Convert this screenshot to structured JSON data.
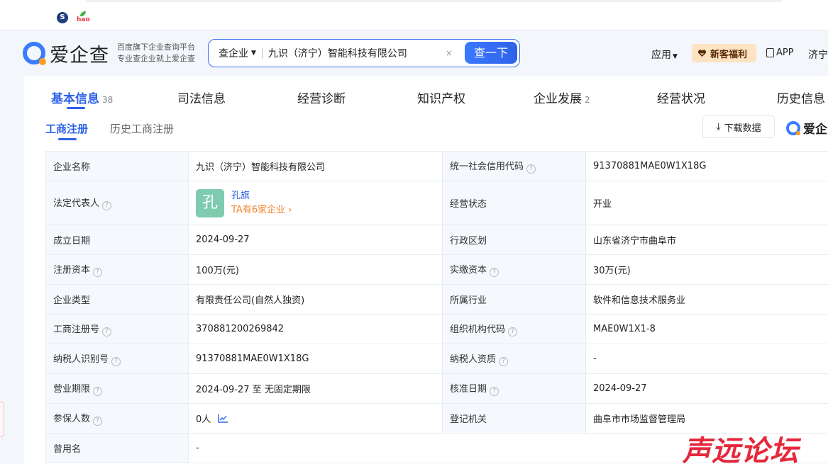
{
  "browser": {
    "favicons": [
      "sogou-icon",
      "hao-icon"
    ],
    "hao_label": "hao"
  },
  "header": {
    "logo_text": "爱企查",
    "slogan_line1": "百度旗下企业查询平台",
    "slogan_line2": "专业查企业就上爱企查",
    "search_type": "查企业",
    "search_value": "九识（济宁）智能科技有限公司",
    "search_button": "查一下",
    "apps": "应用",
    "gift": "新客福利",
    "app": "APP",
    "user": "济宁"
  },
  "tabs": [
    {
      "label": "基本信息",
      "count": "38"
    },
    {
      "label": "司法信息",
      "count": ""
    },
    {
      "label": "经营诊断",
      "count": ""
    },
    {
      "label": "知识产权",
      "count": ""
    },
    {
      "label": "企业发展",
      "count": "2"
    },
    {
      "label": "经营状况",
      "count": ""
    },
    {
      "label": "历史信息",
      "count": ""
    }
  ],
  "subtabs": [
    "工商注册",
    "历史工商注册"
  ],
  "download_label": "下载数据",
  "mini_logo": "爱企",
  "table": {
    "company_name_label": "企业名称",
    "company_name": "九识（济宁）智能科技有限公司",
    "credit_code_label": "统一社会信用代码",
    "credit_code": "91370881MAE0W1X18G",
    "legal_rep_label": "法定代表人",
    "legal_rep_avatar": "孔",
    "legal_rep_name": "孔旗",
    "legal_rep_more": "TA有6家企业",
    "status_label": "经营状态",
    "status": "开业",
    "founded_label": "成立日期",
    "founded": "2024-09-27",
    "region_label": "行政区划",
    "region": "山东省济宁市曲阜市",
    "reg_capital_label": "注册资本",
    "reg_capital": "100万(元)",
    "paid_capital_label": "实缴资本",
    "paid_capital": "30万(元)",
    "type_label": "企业类型",
    "type": "有限责任公司(自然人独资)",
    "industry_label": "所属行业",
    "industry": "软件和信息技术服务业",
    "reg_no_label": "工商注册号",
    "reg_no": "370881200269842",
    "org_code_label": "组织机构代码",
    "org_code": "MAE0W1X1-8",
    "taxpayer_id_label": "纳税人识别号",
    "taxpayer_id": "91370881MAE0W1X18G",
    "taxpayer_qual_label": "纳税人资质",
    "taxpayer_qual": "-",
    "term_label": "营业期限",
    "term": "2024-09-27 至 无固定期限",
    "approval_date_label": "核准日期",
    "approval_date": "2024-09-27",
    "insured_label": "参保人数",
    "insured": "0人",
    "authority_label": "登记机关",
    "authority": "曲阜市市场监督管理局",
    "former_name_label": "曾用名",
    "former_name": "-"
  },
  "watermark": "声远论坛",
  "colors": {
    "accent": "#2d62e8",
    "orange": "#f0812a",
    "label_bg": "#f5f8fd"
  }
}
